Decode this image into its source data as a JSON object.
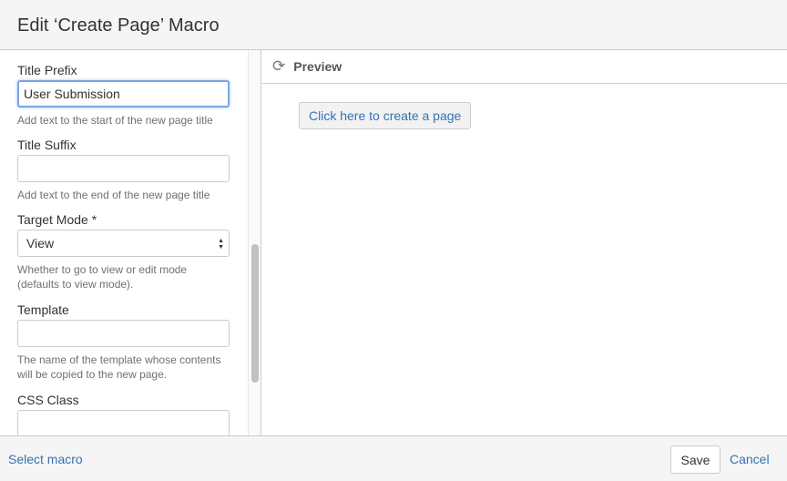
{
  "dialog": {
    "title": "Edit ‘Create Page’ Macro"
  },
  "form": {
    "title_prefix": {
      "label": "Title Prefix",
      "value": "User Submission",
      "help": "Add text to the start of the new page title"
    },
    "title_suffix": {
      "label": "Title Suffix",
      "value": "",
      "help": "Add text to the end of the new page title"
    },
    "target_mode": {
      "label": "Target Mode *",
      "value": "View",
      "help1": "Whether to go to view or edit mode",
      "help2": "(defaults to view mode)."
    },
    "template": {
      "label": "Template",
      "value": "",
      "help1": "The name of the template whose contents",
      "help2": "will be copied to the new page."
    },
    "css_class": {
      "label": "CSS Class",
      "value": ""
    }
  },
  "preview": {
    "title": "Preview",
    "button": "Click here to create a page",
    "icon": "refresh-icon"
  },
  "footer": {
    "select_macro": "Select macro",
    "save": "Save",
    "cancel": "Cancel"
  },
  "colors": {
    "link": "#3572b0",
    "focus": "#7aa7e6"
  }
}
